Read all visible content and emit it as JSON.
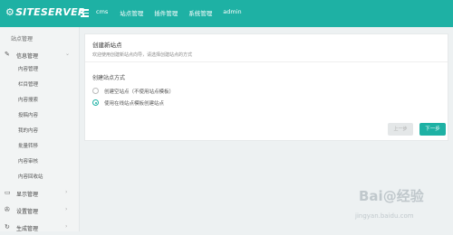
{
  "header": {
    "logo_text": "SITESERVER",
    "nav": [
      "cms",
      "站点管理",
      "插件管理",
      "系统管理",
      "admin"
    ]
  },
  "sidebar": {
    "title": "站点管理",
    "groups": [
      {
        "icon": "edit-icon",
        "label": "信息管理",
        "expanded": true
      },
      {
        "icon": "monitor-icon",
        "label": "显示管理"
      },
      {
        "icon": "wrench-icon",
        "label": "设置管理"
      },
      {
        "icon": "reload-icon",
        "label": "生成管理"
      }
    ],
    "sub_items": [
      "内容管理",
      "栏目管理",
      "内容搜索",
      "投稿内容",
      "我的内容",
      "批量转移",
      "内容审核",
      "内容回收站"
    ]
  },
  "panel": {
    "title": "创建新站点",
    "desc": "欢迎使用创建新站点向导，请选择创建站点的方式",
    "section": "创建站点方式",
    "options": [
      "创建空站点（不使用站点模板）",
      "使用在线站点模板创建站点"
    ],
    "selected_index": 1,
    "prev_label": "上一步",
    "next_label": "下一步"
  },
  "watermark": {
    "text": "Bai@经验",
    "url": "jingyan.baidu.com"
  },
  "colors": {
    "accent": "#1eb1a4",
    "sidebar_bg": "#f2f4f4",
    "page_bg": "#edf1f2"
  }
}
